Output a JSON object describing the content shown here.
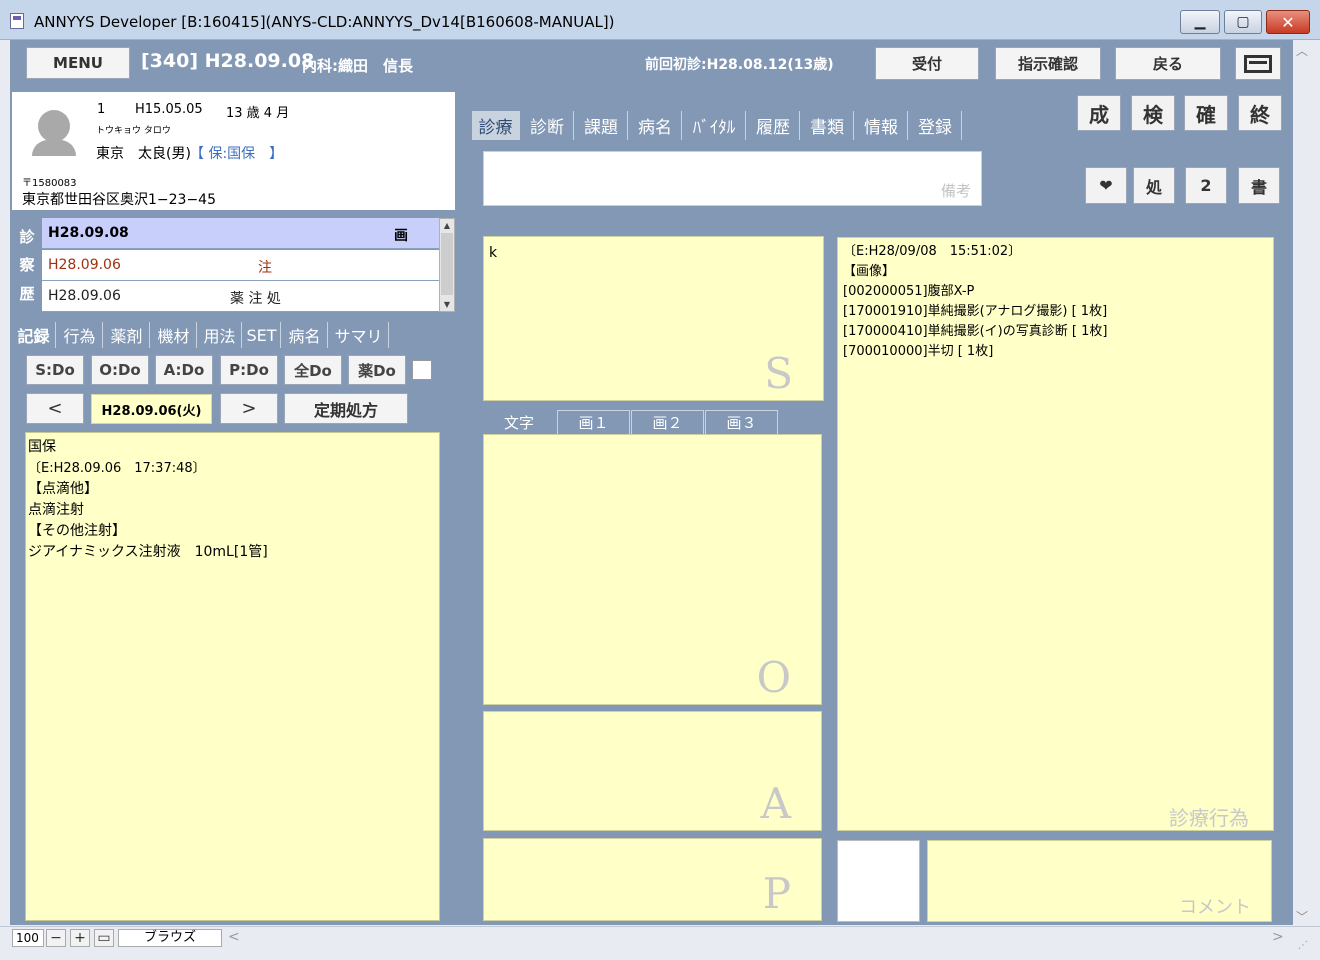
{
  "window": {
    "title": "ANNYYS Developer [B:160415](ANYS-CLD:ANNYYS_Dv14[B160608-MANUAL])",
    "min_icon": "▁",
    "max_icon": "▢",
    "close_icon": "✕"
  },
  "header": {
    "menu_label": "MENU",
    "visit_info": "[340] H28.09.08",
    "dept_doctor": "内科:織田　信長",
    "prev_visit": "前回初診:H28.08.12(13歳)",
    "reception_label": "受付",
    "instruction_label": "指示確認",
    "back_label": "戻る"
  },
  "patient": {
    "id": "1",
    "birthdate": "H15.05.05",
    "age": "13 歳 4 月",
    "kana": "トウキョウ タロウ",
    "name": "東京　太良(男)",
    "insurance": "【 保:国保　】",
    "postal": "〒1580083",
    "address": "東京都世田谷区奥沢1−23−45"
  },
  "history": {
    "side_label": [
      "診",
      "察",
      "歴"
    ],
    "rows": [
      {
        "date": "H28.09.08",
        "marks": "画"
      },
      {
        "date": "H28.09.06",
        "marks": "注"
      },
      {
        "date": "H28.09.06",
        "marks": "薬 注 処"
      }
    ]
  },
  "left_tabs": [
    "記録",
    "行為",
    "薬剤",
    "機材",
    "用法",
    "SET",
    "病名",
    "サマリ"
  ],
  "do_buttons": [
    "S:Do",
    "O:Do",
    "A:Do",
    "P:Do",
    "全Do",
    "薬Do"
  ],
  "date_nav": {
    "prev": "<",
    "date": "H28.09.06(火)",
    "next": ">",
    "regular_rx": "定期処方"
  },
  "record_lines": [
    "国保",
    "〔E:H28.09.06　17:37:48〕",
    "【点滴他】",
    "点滴注射",
    "【その他注射】",
    "ジアイナミックス注射液　10mL[1管]"
  ],
  "right_tabs": [
    "診療",
    "診断",
    "課題",
    "病名",
    "ﾊﾞｲﾀﾙ",
    "履歴",
    "書類",
    "情報",
    "登録"
  ],
  "kanji_buttons": [
    "成",
    "検",
    "確",
    "終"
  ],
  "small_buttons": [
    "❤",
    "処",
    "2",
    "書"
  ],
  "remarks_label": "備考",
  "soap": {
    "s_text": "k",
    "s_label": "S",
    "o_label": "O",
    "a_label": "A",
    "p_label": "P",
    "o_tabs": [
      "文字",
      "画１",
      "画２",
      "画３"
    ]
  },
  "treatment": {
    "lines": [
      "〔E:H28/09/08　15:51:02〕",
      "【画像】",
      "[002000051]腹部X-P",
      "[170001910]単純撮影(アナログ撮影) [ 1枚]",
      "[170000410]単純撮影(イ)の写真診断 [ 1枚]",
      "[700010000]半切 [ 1枚]"
    ],
    "label": "診療行為"
  },
  "comment_label": "コメント",
  "statusbar": {
    "zoom": "100",
    "browse": "ブラウズ"
  },
  "colors": {
    "panel": "#8298b4",
    "note_bg": "#ffffc8",
    "selected_row": "#c8cffa",
    "history_injection": "#a03010",
    "insurance": "#3b6fc2"
  }
}
